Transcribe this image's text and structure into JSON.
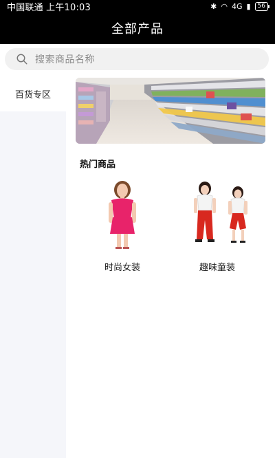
{
  "status_bar": {
    "carrier_time": "中国联通 上午10:03",
    "battery": "56",
    "network": "4G"
  },
  "header": {
    "title": "全部产品"
  },
  "search": {
    "placeholder": "搜索商品名称"
  },
  "sidebar": {
    "items": [
      {
        "label": "百货专区"
      }
    ]
  },
  "main": {
    "banner": {
      "icon": "store-shelves-image"
    },
    "hot_section": {
      "title": "热门商品",
      "products": [
        {
          "label": "时尚女装",
          "icon": "woman-dress-image",
          "accent": "#e8236a"
        },
        {
          "label": "趣味童装",
          "icon": "kids-outfit-image",
          "accent": "#d8281f"
        }
      ]
    }
  }
}
